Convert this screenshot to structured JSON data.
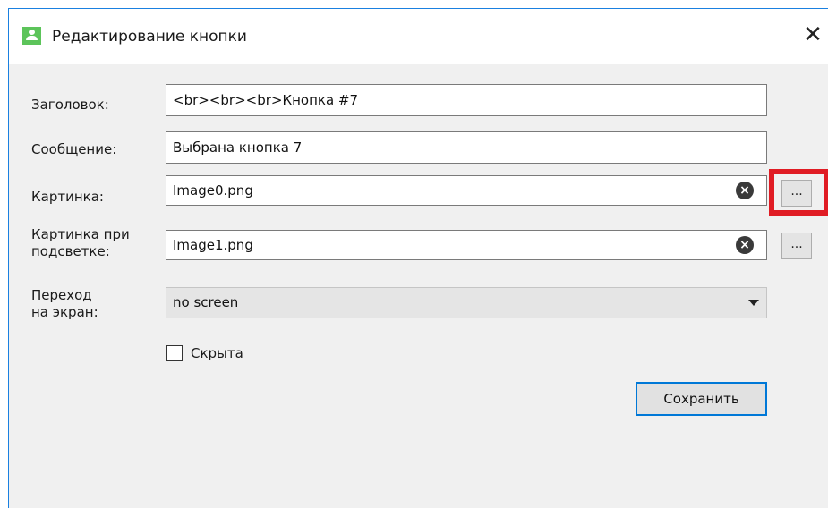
{
  "window": {
    "title": "Редактирование кнопки",
    "close_glyph": "✕"
  },
  "form": {
    "title_label": "Заголовок:",
    "title_value": "<br><br><br>Кнопка #7",
    "message_label": "Сообщение:",
    "message_value": "Выбрана кнопка 7",
    "image_label": "Картинка:",
    "image_value": "Image0.png",
    "hover_image_label_line1": "Картинка при",
    "hover_image_label_line2": "подсветке:",
    "hover_image_value": "Image1.png",
    "transition_label_line1": "Переход",
    "transition_label_line2": "на экран:",
    "transition_value": "no screen",
    "hidden_label": "Скрыта",
    "hidden_checked": false,
    "browse_label": "...",
    "clear_glyph": "×",
    "save_label": "Сохранить"
  },
  "colors": {
    "accent": "#0078d7",
    "highlight": "#e01c24",
    "app_icon": "#5cc45a"
  },
  "icons": [
    "app-user-icon",
    "close-icon",
    "clear-icon",
    "chevron-down-icon"
  ]
}
